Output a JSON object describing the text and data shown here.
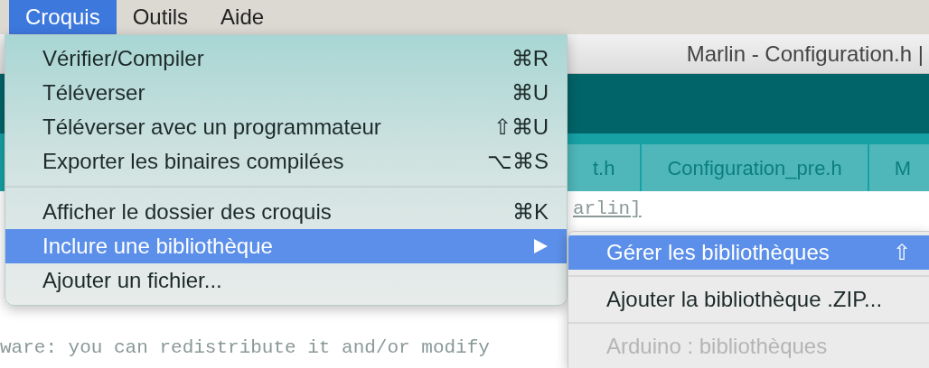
{
  "menubar": [
    {
      "label": "Croquis",
      "selected": true
    },
    {
      "label": "Outils",
      "selected": false
    },
    {
      "label": "Aide",
      "selected": false
    }
  ],
  "window": {
    "title": "Marlin - Configuration.h |"
  },
  "tabs": [
    {
      "label": "t.h",
      "selected": false
    },
    {
      "label": "Configuration_pre.h",
      "selected": false
    },
    {
      "label": "M",
      "selected": false
    }
  ],
  "editor": {
    "lines": [
      {
        "text": "arlin]",
        "kind": "link"
      },
      {
        "text": "ware: you can redistribute it and/or modify",
        "kind": "comment"
      }
    ]
  },
  "menu": {
    "sections": [
      [
        {
          "label": "Vérifier/Compiler",
          "shortcut": "⌘R",
          "selected": false,
          "submenu": false
        },
        {
          "label": "Téléverser",
          "shortcut": "⌘U",
          "selected": false,
          "submenu": false
        },
        {
          "label": "Téléverser avec un programmateur",
          "shortcut": "⇧⌘U",
          "selected": false,
          "submenu": false
        },
        {
          "label": "Exporter les binaires compilées",
          "shortcut": "⌥⌘S",
          "selected": false,
          "submenu": false
        }
      ],
      [
        {
          "label": "Afficher le dossier des croquis",
          "shortcut": "⌘K",
          "selected": false,
          "submenu": false
        },
        {
          "label": "Inclure une bibliothèque",
          "selected": true,
          "submenu": true
        },
        {
          "label": "Ajouter un fichier...",
          "selected": false,
          "submenu": false
        }
      ]
    ]
  },
  "submenu": {
    "sections": [
      [
        {
          "label": "Gérer les bibliothèques",
          "shortcut": "⇧",
          "selected": true,
          "disabled": false
        }
      ],
      [
        {
          "label": "Ajouter la bibliothèque .ZIP...",
          "selected": false,
          "disabled": false
        }
      ],
      [
        {
          "label": "Arduino : bibliothèques",
          "selected": false,
          "disabled": true
        }
      ]
    ]
  }
}
